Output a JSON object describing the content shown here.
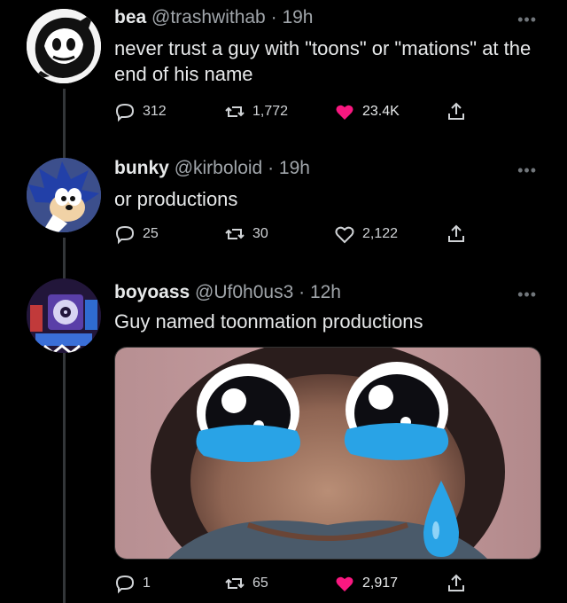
{
  "tweets": [
    {
      "name": "bea",
      "handle": "@trashwithab",
      "time": "19h",
      "text": "never trust a guy with \"toons\" or \"mations\" at the end of his name",
      "replies": "312",
      "retweets": "1,772",
      "likes": "23.4K",
      "liked": true
    },
    {
      "name": "bunky",
      "handle": "@kirboloid",
      "time": "19h",
      "text": "or productions",
      "replies": "25",
      "retweets": "30",
      "likes": "2,122",
      "liked": false
    },
    {
      "name": "boyoass",
      "handle": "@Uf0h0us3",
      "time": "12h",
      "text": "Guy named toonmation productions",
      "replies": "1",
      "retweets": "65",
      "likes": "2,917",
      "liked": true
    }
  ],
  "more_label": "•••",
  "separator": "·",
  "colors": {
    "like": "#f91880",
    "muted": "#71767b",
    "text": "#e7e9ea"
  },
  "icons": [
    "reply-icon",
    "retweet-icon",
    "heart-icon",
    "share-icon",
    "more-icon"
  ]
}
